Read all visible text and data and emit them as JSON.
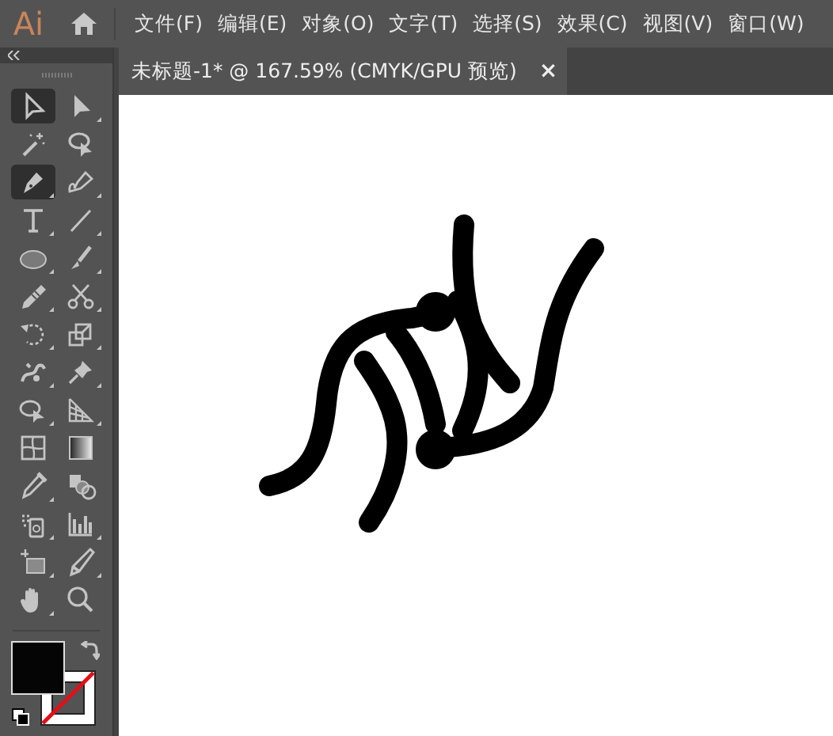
{
  "app": {
    "logo": "Ai"
  },
  "menu": [
    "文件(F)",
    "编辑(E)",
    "对象(O)",
    "文字(T)",
    "选择(S)",
    "效果(C)",
    "视图(V)",
    "窗口(W)"
  ],
  "tabs": [
    {
      "label": "未标题-1* @ 167.59% (CMYK/GPU 预览)",
      "selected": true,
      "close": "×"
    }
  ],
  "tools": [
    {
      "kind": "selection",
      "selected": true
    },
    {
      "kind": "direct",
      "selected": false
    },
    {
      "kind": "wand",
      "selected": false
    },
    {
      "kind": "lasso",
      "selected": false
    },
    {
      "kind": "pen",
      "selected": true
    },
    {
      "kind": "curvature",
      "selected": false
    },
    {
      "kind": "type",
      "selected": false
    },
    {
      "kind": "line",
      "selected": false
    },
    {
      "kind": "ellipse",
      "selected": false
    },
    {
      "kind": "brush",
      "selected": false
    },
    {
      "kind": "pencil",
      "selected": false
    },
    {
      "kind": "scissors",
      "selected": false
    },
    {
      "kind": "rotate",
      "selected": false
    },
    {
      "kind": "scale",
      "selected": false
    },
    {
      "kind": "warp",
      "selected": false
    },
    {
      "kind": "pin",
      "selected": false
    },
    {
      "kind": "shapebuilder",
      "selected": false
    },
    {
      "kind": "perspective",
      "selected": false
    },
    {
      "kind": "mesh",
      "selected": false
    },
    {
      "kind": "gradient",
      "selected": false
    },
    {
      "kind": "eyedropper",
      "selected": false
    },
    {
      "kind": "blend",
      "selected": false
    },
    {
      "kind": "sprayer",
      "selected": false
    },
    {
      "kind": "graph",
      "selected": false
    },
    {
      "kind": "artboard",
      "selected": false
    },
    {
      "kind": "slice",
      "selected": false
    },
    {
      "kind": "hand",
      "selected": false
    },
    {
      "kind": "zoom",
      "selected": false
    }
  ],
  "fill_stroke": {
    "fill_in_front": true
  }
}
